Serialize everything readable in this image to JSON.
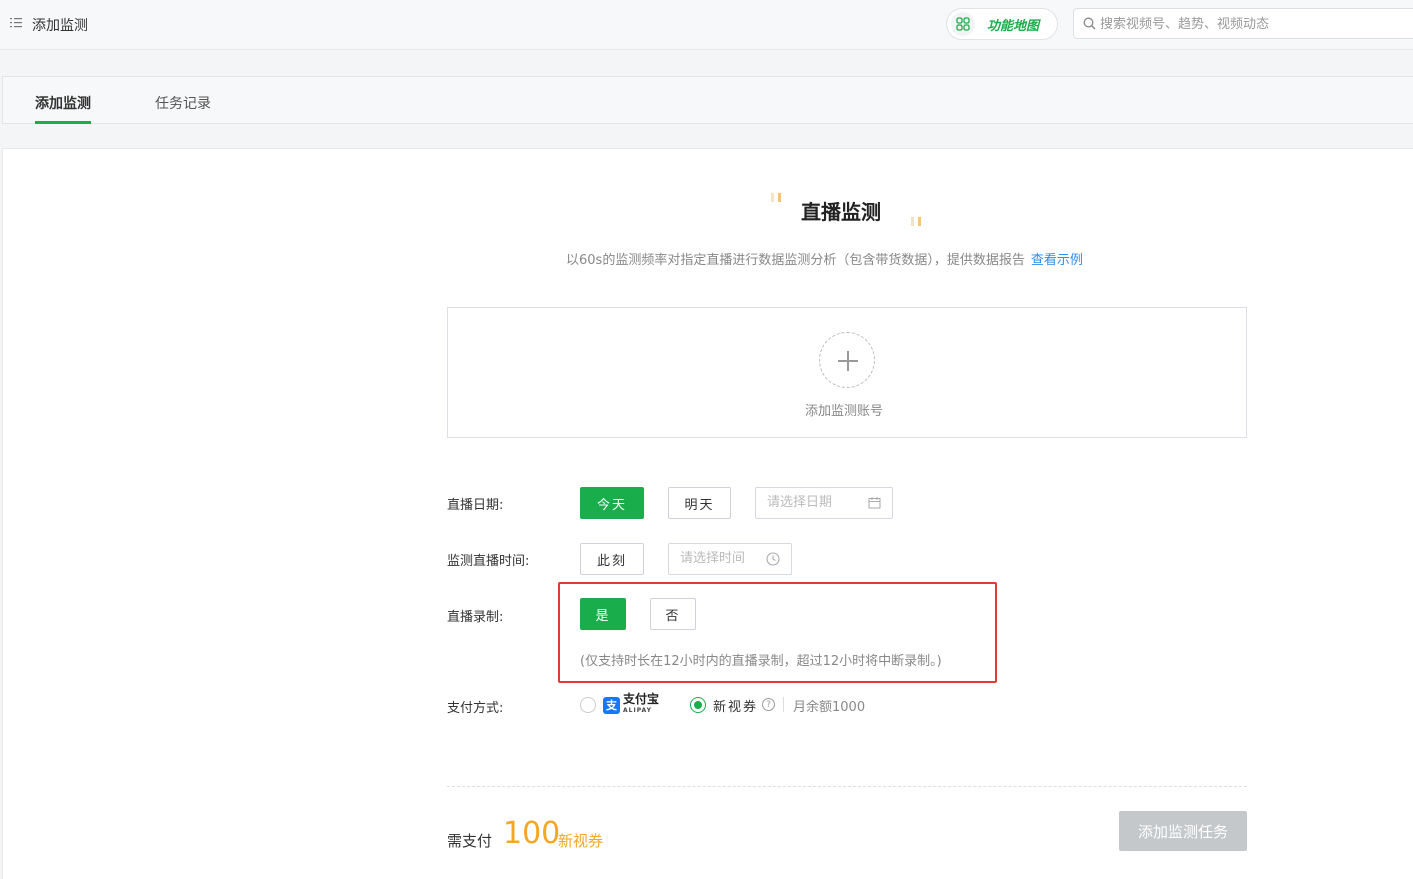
{
  "header": {
    "page_title": "添加监测",
    "function_map_label": "功能地图",
    "search_placeholder": "搜索视频号、趋势、视频动态"
  },
  "tabs": [
    {
      "label": "添加监测",
      "active": true
    },
    {
      "label": "任务记录",
      "active": false
    }
  ],
  "main": {
    "title": "直播监测",
    "description": "以60s的监测频率对指定直播进行数据监测分析（包含带货数据），提供数据报告",
    "example_link": "查看示例",
    "add_account_label": "添加监测账号"
  },
  "form": {
    "date_label": "直播日期:",
    "date_today": "今天",
    "date_tomorrow": "明天",
    "date_placeholder": "请选择日期",
    "time_label": "监测直播时间:",
    "time_now": "此刻",
    "time_placeholder": "请选择时间",
    "record_label": "直播录制:",
    "record_yes": "是",
    "record_no": "否",
    "record_note": "(仅支持时长在12小时内的直播录制，超过12小时将中断录制。)",
    "payment_label": "支付方式:",
    "alipay_label": "支付宝",
    "alipay_sub": "ALIPAY",
    "voucher_label": "新视券",
    "balance_text": "月余额1000"
  },
  "footer": {
    "pay_label": "需支付",
    "amount": "100",
    "unit": "新视券",
    "submit_label": "添加监测任务"
  },
  "colors": {
    "accent": "#1aad4b",
    "highlight_box": "#e53935",
    "amount": "#f5a623",
    "link": "#2d8cf0"
  }
}
